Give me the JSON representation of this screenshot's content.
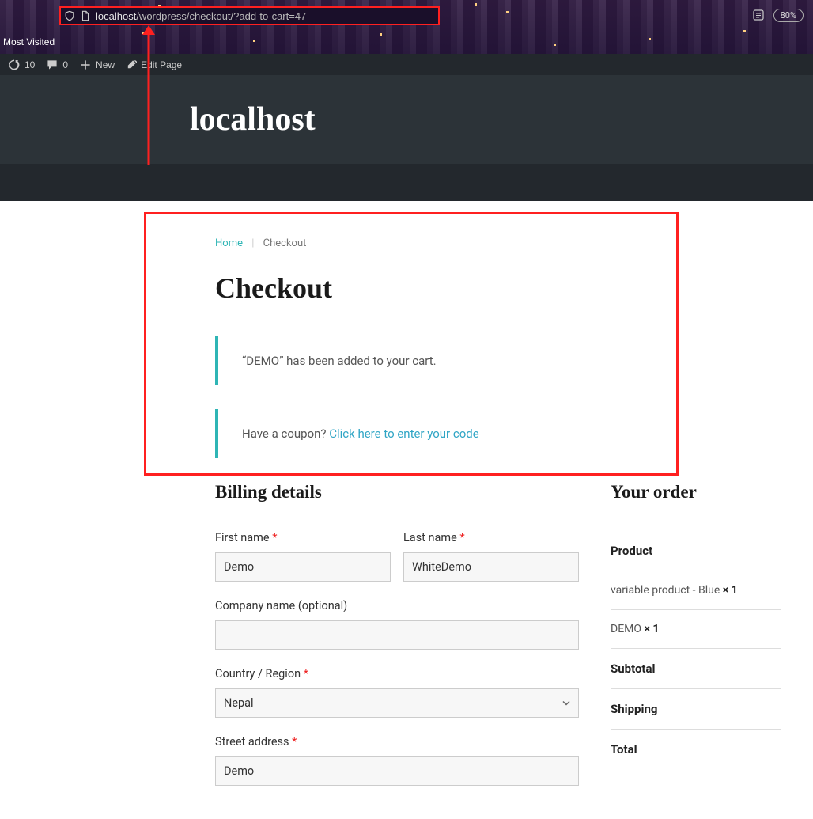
{
  "browser": {
    "url_host": "localhost",
    "url_path": "/wordpress/checkout/?add-to-cart=47",
    "most_visited": "Most Visited",
    "zoom": "80%"
  },
  "adminbar": {
    "updates": "10",
    "comments": "0",
    "new": "New",
    "edit": "Edit Page"
  },
  "site": {
    "title": "localhost"
  },
  "breadcrumb": {
    "home": "Home",
    "current": "Checkout"
  },
  "page": {
    "title": "Checkout"
  },
  "notices": {
    "added": "“DEMO” has been added to your cart.",
    "coupon_prompt": "Have a coupon? ",
    "coupon_link": "Click here to enter your code"
  },
  "billing": {
    "heading": "Billing details",
    "first_name_label": "First name ",
    "first_name_value": "Demo",
    "last_name_label": "Last name ",
    "last_name_value": "WhiteDemo",
    "company_label": "Company name (optional)",
    "company_value": "",
    "country_label": "Country / Region ",
    "country_value": "Nepal",
    "street_label": "Street address ",
    "street_value": "Demo"
  },
  "order": {
    "heading": "Your order",
    "product_header": "Product",
    "items": [
      {
        "name": "variable product - Blue ",
        "qty": "× 1"
      },
      {
        "name": "DEMO ",
        "qty": "× 1"
      }
    ],
    "subtotal": "Subtotal",
    "shipping": "Shipping",
    "total": "Total"
  }
}
